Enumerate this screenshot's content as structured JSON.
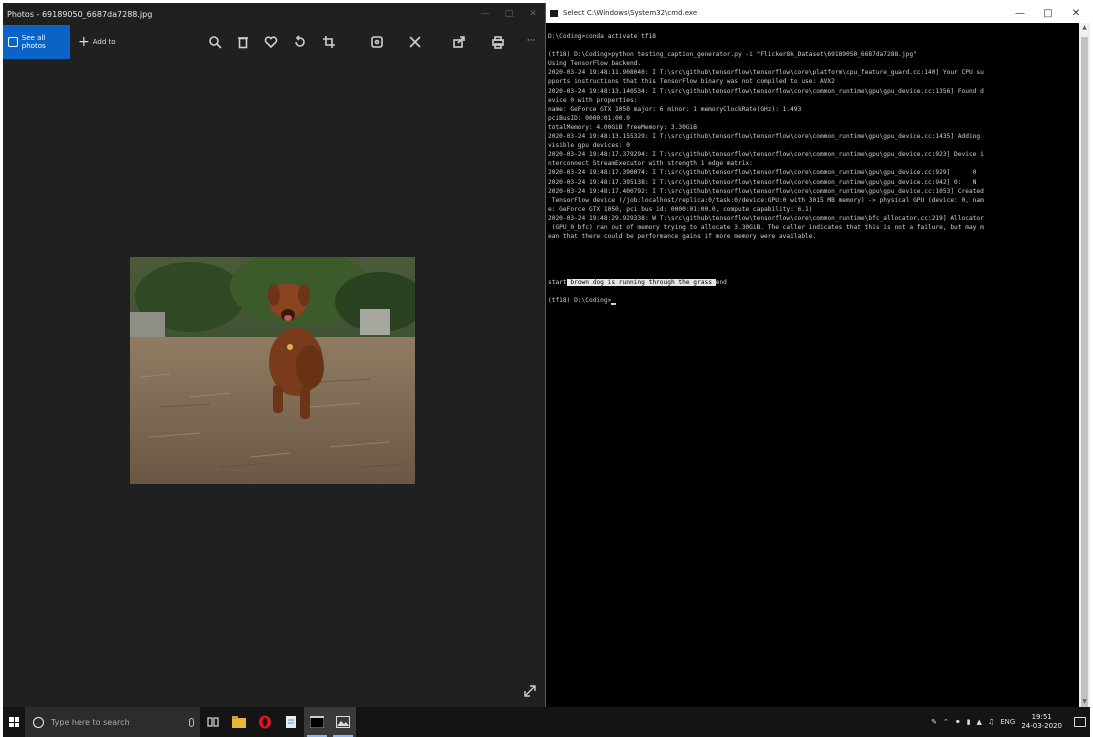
{
  "photos": {
    "window_title": "Photos - 69189050_6687da7288.jpg",
    "see_all_label": "See all photos",
    "add_to_label": "Add to",
    "toolbar_icons": [
      "zoom-icon",
      "delete-icon",
      "heart-icon",
      "rotate-icon",
      "crop-icon",
      "enhance-icon",
      "edit-icon",
      "share-icon",
      "print-icon",
      "more-icon"
    ],
    "more_label": "···"
  },
  "cmd": {
    "window_title": "Select C:\\Windows\\System32\\cmd.exe",
    "lines": [
      "D:\\Coding>conda activate tf18",
      "",
      "(tf18) D:\\Coding>python testing_caption_generator.py -i \"Flicker8k_Dataset\\69189050_6687da7288.jpg\"",
      "Using TensorFlow backend.",
      "2020-03-24 19:48:11.908040: I T:\\src\\github\\tensorflow\\tensorflow\\core\\platform\\cpu_feature_guard.cc:140] Your CPU su",
      "pports instructions that this TensorFlow binary was not compiled to use: AVX2",
      "2020-03-24 19:48:13.140534: I T:\\src\\github\\tensorflow\\tensorflow\\core\\common_runtime\\gpu\\gpu_device.cc:1356] Found d",
      "evice 0 with properties:",
      "name: GeForce GTX 1050 major: 6 minor: 1 memoryClockRate(GHz): 1.493",
      "pciBusID: 0000:01:00.0",
      "totalMemory: 4.00GiB freeMemory: 3.30GiB",
      "2020-03-24 19:48:13.155329: I T:\\src\\github\\tensorflow\\tensorflow\\core\\common_runtime\\gpu\\gpu_device.cc:1435] Adding",
      "visible gpu devices: 0",
      "2020-03-24 19:48:17.379294: I T:\\src\\github\\tensorflow\\tensorflow\\core\\common_runtime\\gpu\\gpu_device.cc:923] Device i",
      "nterconnect StreamExecutor with strength 1 edge matrix:",
      "2020-03-24 19:48:17.390074: I T:\\src\\github\\tensorflow\\tensorflow\\core\\common_runtime\\gpu\\gpu_device.cc:929]      0",
      "2020-03-24 19:48:17.395138: I T:\\src\\github\\tensorflow\\tensorflow\\core\\common_runtime\\gpu\\gpu_device.cc:942] 0:   N",
      "2020-03-24 19:48:17.400792: I T:\\src\\github\\tensorflow\\tensorflow\\core\\common_runtime\\gpu\\gpu_device.cc:1053] Created",
      " TensorFlow device (/job:localhost/replica:0/task:0/device:GPU:0 with 3015 MB memory) -> physical GPU (device: 0, nam",
      "e: GeForce GTX 1050, pci bus id: 0000:01:00.0, compute capability: 6.1)",
      "2020-03-24 19:48:29.929338: W T:\\src\\github\\tensorflow\\tensorflow\\core\\common_runtime\\bfc_allocator.cc:219] Allocator",
      " (GPU_0_bfc) ran out of memory trying to allocate 3.30GiB. The caller indicates that this is not a failure, but may m",
      "ean that there could be performance gains if more memory were available.",
      "",
      "",
      "",
      ""
    ],
    "caption_prefix": "start",
    "caption_text": " brown dog is running through the grass ",
    "caption_suffix": "end",
    "prompt": "(tf18) D:\\Coding>"
  },
  "taskbar": {
    "search_placeholder": "Type here to search",
    "apps": [
      "task-view-icon",
      "file-explorer-icon",
      "opera-icon",
      "notepad-icon",
      "cmd-icon",
      "photos-icon"
    ],
    "language": "ENG",
    "time": "19:51",
    "date": "24-03-2020"
  }
}
